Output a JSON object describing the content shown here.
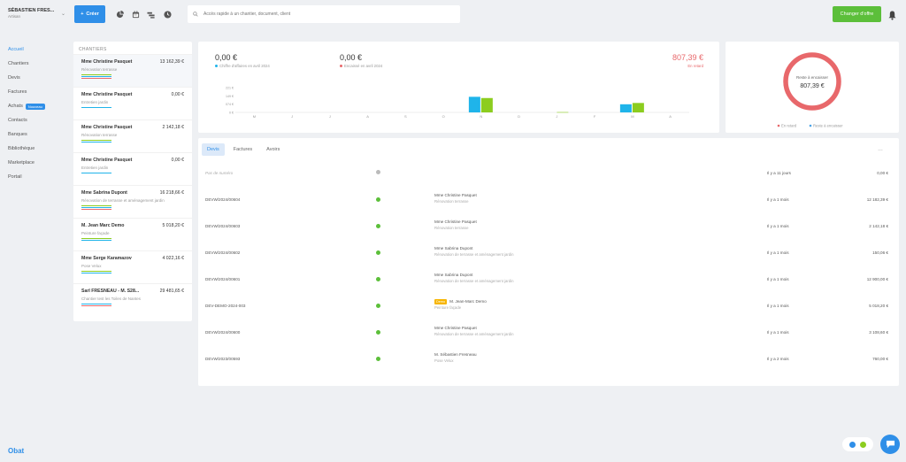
{
  "company": {
    "name": "SÉBASTIEN FRES...",
    "role": "Artisan"
  },
  "toolbar": {
    "create_label": "Créer",
    "offer_label": "Changer d'offre"
  },
  "search": {
    "placeholder": "Accès rapide à un chantier, document, client"
  },
  "sidebar": {
    "items": [
      {
        "label": "Accueil",
        "active": true
      },
      {
        "label": "Chantiers"
      },
      {
        "label": "Devis"
      },
      {
        "label": "Factures"
      },
      {
        "label": "Achats",
        "badge": "Nouveau"
      },
      {
        "label": "Contacts"
      },
      {
        "label": "Banques"
      },
      {
        "label": "Bibliothèque"
      },
      {
        "label": "Marketplace"
      },
      {
        "label": "Portail"
      }
    ]
  },
  "logo": "Obat",
  "chantiers": {
    "title": "CHANTIERS",
    "items": [
      {
        "name": "Mme Christine Pasquet",
        "amount": "13 162,39 €",
        "sub": "Rénovation terrasse"
      },
      {
        "name": "Mme Christine Pasquet",
        "amount": "0,00 €",
        "sub": "Entretien jardin"
      },
      {
        "name": "Mme Christine Pasquet",
        "amount": "2 142,18 €",
        "sub": "Rénovation terrasse"
      },
      {
        "name": "Mme Christine Pasquet",
        "amount": "0,00 €",
        "sub": "Entretien jardin"
      },
      {
        "name": "Mme Sabrina Dupont",
        "amount": "16 218,66 €",
        "sub": "Rénovation de terrasse et aménagement jardin"
      },
      {
        "name": "M. Jean Marc Demo",
        "amount": "5 018,20 €",
        "sub": "Peinture façade"
      },
      {
        "name": "Mme Serge Karamazov",
        "amount": "4 022,16 €",
        "sub": "Pose Velux"
      },
      {
        "name": "Sarl FRESNEAU - M. S28...",
        "amount": "29 481,65 €",
        "sub": "Chantier test les Toiles de Nantes"
      }
    ]
  },
  "stats": {
    "revenue": {
      "value": "0,00 €",
      "label": "Chiffre d'affaires en avril 2024"
    },
    "collected": {
      "value": "0,00 €",
      "label": "Encaissé en avril 2024"
    },
    "late": {
      "value": "807,39 €",
      "label": "En retard"
    }
  },
  "chart_data": {
    "type": "bar",
    "categories": [
      "M",
      "J",
      "J",
      "A",
      "S",
      "O",
      "N",
      "D",
      "J",
      "F",
      "M",
      "A"
    ],
    "series": [
      {
        "values": [
          0,
          0,
          0,
          0,
          0,
          0,
          21500,
          0,
          0,
          0,
          11200,
          0
        ],
        "color": "#1fb4ea"
      },
      {
        "values": [
          0,
          0,
          0,
          0,
          0,
          0,
          19800,
          0,
          400,
          0,
          13000,
          0
        ],
        "color": "#8ccd1f"
      }
    ],
    "yticks": [
      "25 221 €",
      "34 149 €",
      "17 074 €",
      "0 €"
    ],
    "ylim": [
      0,
      34149
    ]
  },
  "donut": {
    "label": "Reste à encaisser",
    "value": "807,39 €",
    "legend_late": "En retard",
    "legend_todo": "Reste à encaisser",
    "late_fraction": 1.0,
    "color_late": "#e8686b",
    "color_todo": "#4aa3e8"
  },
  "tabs": [
    {
      "label": "Devis",
      "active": true
    },
    {
      "label": "Factures"
    },
    {
      "label": "Avoirs"
    }
  ],
  "documents": [
    {
      "number": "Pas de numéro",
      "status": "grey",
      "client": "",
      "sub": "",
      "date": "Il y a 11 jours",
      "amount": "0,00 €"
    },
    {
      "number": "DEVW/2024/00604",
      "status": "green",
      "client": "Mme Christine Pasquet",
      "sub": "Rénovation terrasse",
      "date": "Il y a 1 mois",
      "amount": "12 182,39 €"
    },
    {
      "number": "DEVW/2024/00603",
      "status": "green",
      "client": "Mme Christine Pasquet",
      "sub": "Rénovation terrasse",
      "date": "Il y a 1 mois",
      "amount": "2 142,18 €"
    },
    {
      "number": "DEVW/2024/00602",
      "status": "green",
      "client": "Mme Sabrina Dupont",
      "sub": "Rénovation de terrasse et aménagement jardin",
      "date": "Il y a 1 mois",
      "amount": "150,06 €"
    },
    {
      "number": "DEVW/2024/00601",
      "status": "green",
      "client": "Mme Sabrina Dupont",
      "sub": "Rénovation de terrasse et aménagement jardin",
      "date": "Il y a 1 mois",
      "amount": "12 900,00 €"
    },
    {
      "number": "DEV-DEMO-2024-003",
      "status": "green",
      "client": "M. Jean-Marc Demo",
      "tag": "Demo",
      "sub": "Peinture façade",
      "date": "Il y a 1 mois",
      "amount": "5 018,20 €"
    },
    {
      "number": "DEVW/2024/00600",
      "status": "green",
      "client": "Mme Christine Pasquet",
      "sub": "Rénovation de terrasse et aménagement jardin",
      "date": "Il y a 1 mois",
      "amount": "3 108,60 €"
    },
    {
      "number": "DEVW/2023/00593",
      "status": "green",
      "client": "M. Sébastien Fresneau",
      "sub": "Pose Velux",
      "date": "Il y a 2 mois",
      "amount": "760,00 €"
    }
  ]
}
